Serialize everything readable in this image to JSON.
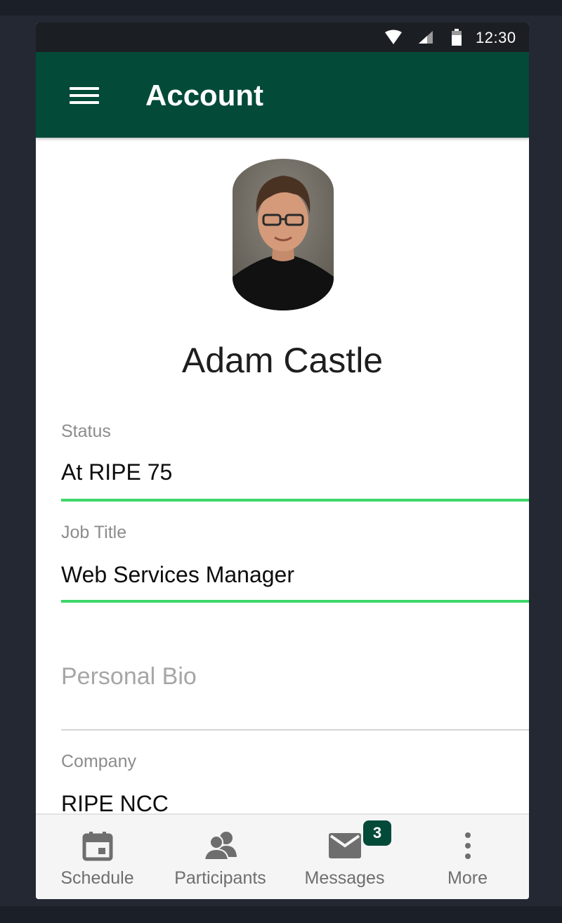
{
  "status_bar": {
    "time": "12:30"
  },
  "app_bar": {
    "title": "Account"
  },
  "profile": {
    "name": "Adam Castle"
  },
  "fields": {
    "status": {
      "label": "Status",
      "value": "At RIPE 75"
    },
    "job_title": {
      "label": "Job Title",
      "value": "Web Services Manager"
    },
    "bio": {
      "placeholder": "Personal Bio"
    },
    "company": {
      "label": "Company",
      "value": "RIPE NCC"
    }
  },
  "bottom_nav": {
    "schedule": "Schedule",
    "participants": "Participants",
    "messages": "Messages",
    "more": "More",
    "messages_badge": "3"
  },
  "colors": {
    "app_bar": "#034a39",
    "field_underline_active": "#3dd86a",
    "badge": "#034a39"
  }
}
